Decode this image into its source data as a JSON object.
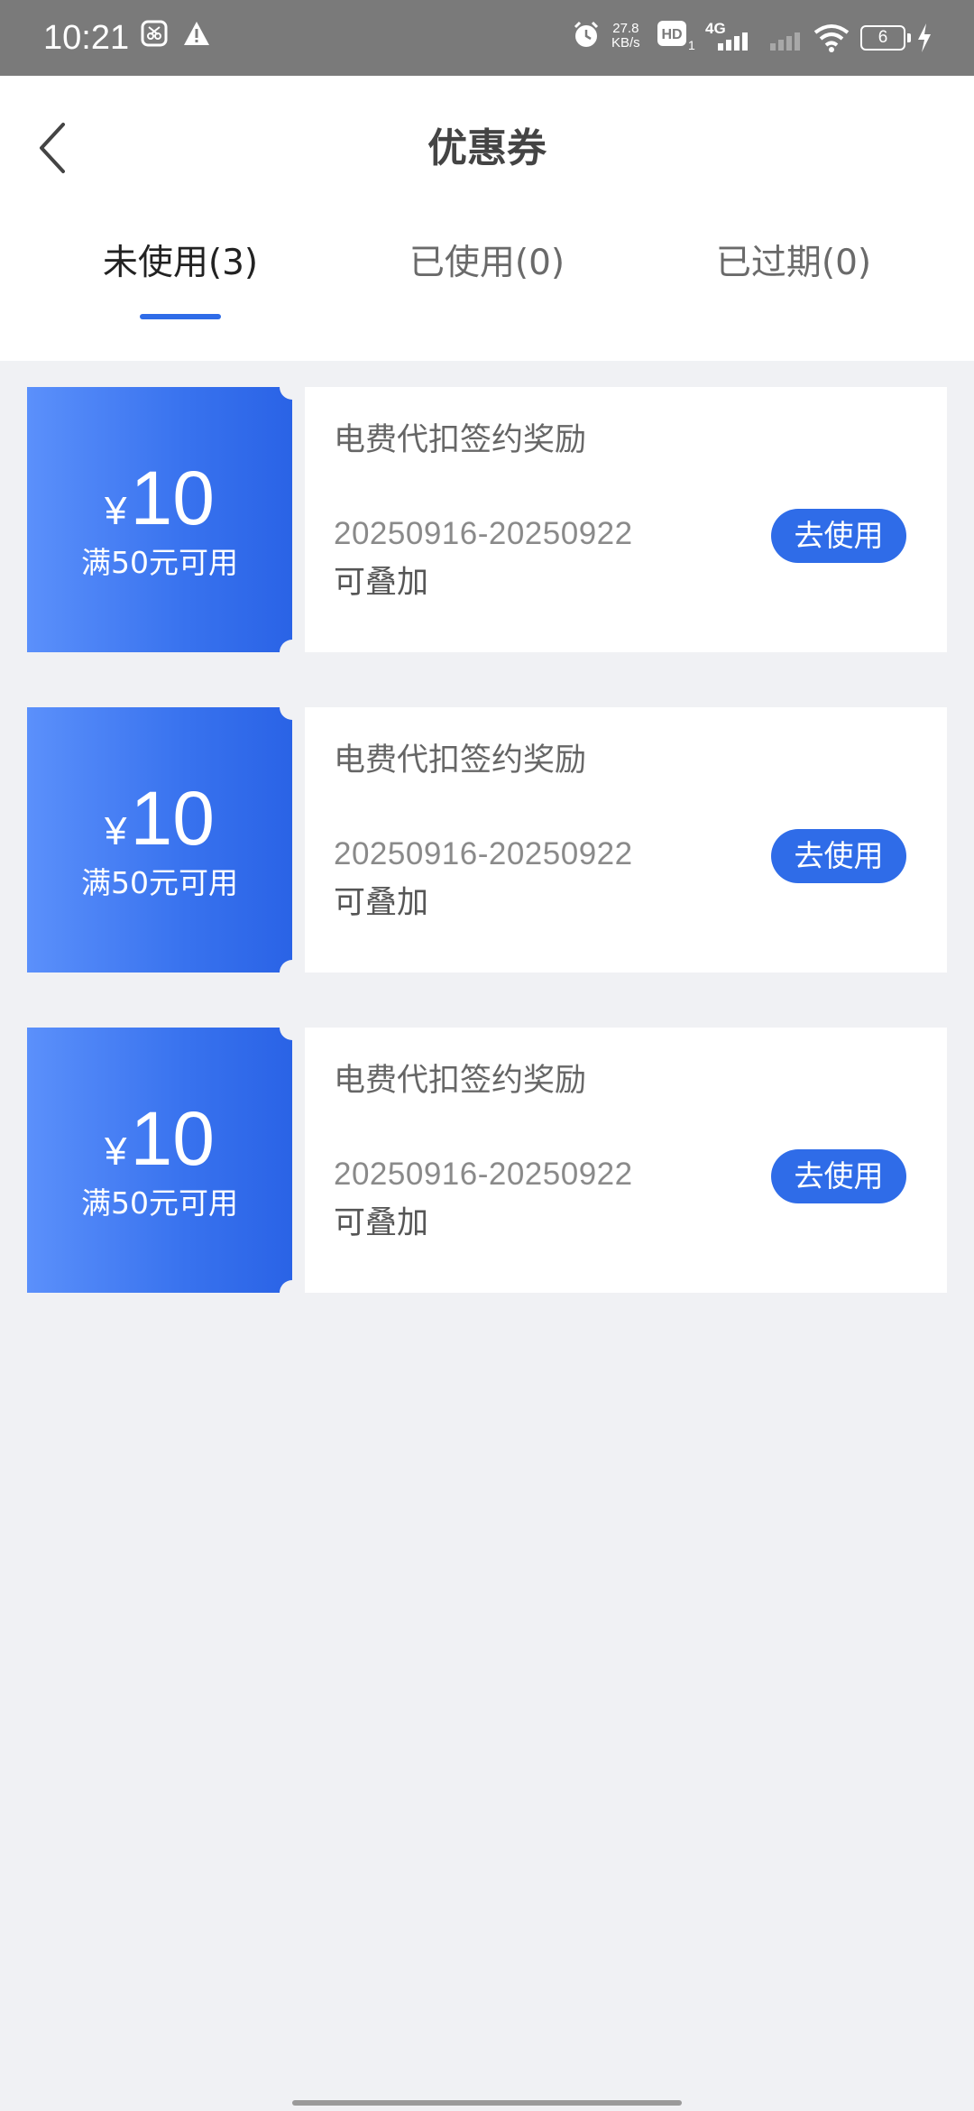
{
  "status_bar": {
    "time": "10:21",
    "speed_value": "27.8",
    "speed_unit": "KB/s",
    "network_type": "4G",
    "hd_sub": "1",
    "battery_level": "6",
    "icons": [
      "screenshot-icon",
      "warning-icon",
      "alarm-icon",
      "hd-icon",
      "signal-icon",
      "signal-weak-icon",
      "wifi-icon",
      "battery-icon",
      "charging-icon"
    ]
  },
  "header": {
    "title": "优惠券",
    "back_icon": "chevron-left-icon"
  },
  "tabs": [
    {
      "label": "未使用(3)",
      "active": true
    },
    {
      "label": "已使用(0)",
      "active": false
    },
    {
      "label": "已过期(0)",
      "active": false
    }
  ],
  "coupons": [
    {
      "currency": "¥",
      "amount": "10",
      "condition": "满50元可用",
      "title": "电费代扣签约奖励",
      "date_range": "20250916-20250922",
      "stack_note": "可叠加",
      "button_label": "去使用"
    },
    {
      "currency": "¥",
      "amount": "10",
      "condition": "满50元可用",
      "title": "电费代扣签约奖励",
      "date_range": "20250916-20250922",
      "stack_note": "可叠加",
      "button_label": "去使用"
    },
    {
      "currency": "¥",
      "amount": "10",
      "condition": "满50元可用",
      "title": "电费代扣签约奖励",
      "date_range": "20250916-20250922",
      "stack_note": "可叠加",
      "button_label": "去使用"
    }
  ],
  "colors": {
    "accent": "#2f6ce8",
    "coupon_gradient_start": "#5b90fb",
    "coupon_gradient_end": "#2a63e6",
    "page_background": "#f0f1f4",
    "status_bar": "#7a7a7a"
  }
}
